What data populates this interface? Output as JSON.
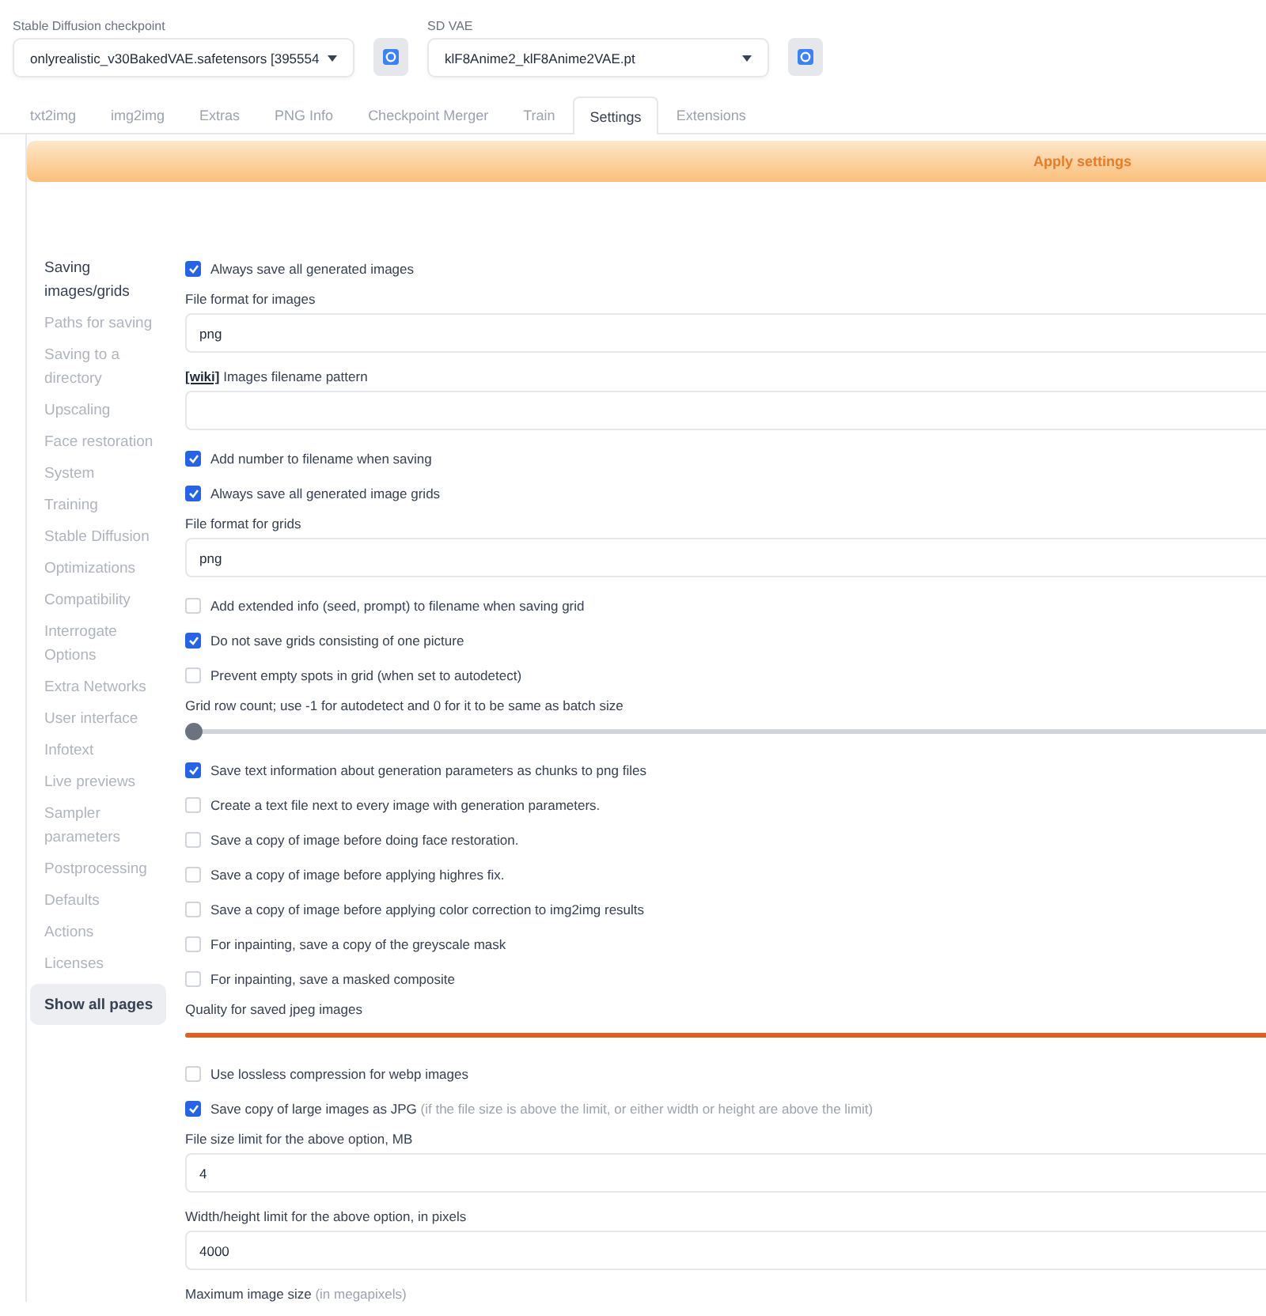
{
  "top_bar": {
    "checkpoint": {
      "label": "Stable Diffusion checkpoint",
      "value": "onlyrealistic_v30BakedVAE.safetensors [395554"
    },
    "vae": {
      "label": "SD VAE",
      "value": "klF8Anime2_klF8Anime2VAE.pt"
    }
  },
  "tabs": [
    {
      "label": "txt2img",
      "selected": false
    },
    {
      "label": "img2img",
      "selected": false
    },
    {
      "label": "Extras",
      "selected": false
    },
    {
      "label": "PNG Info",
      "selected": false
    },
    {
      "label": "Checkpoint Merger",
      "selected": false
    },
    {
      "label": "Train",
      "selected": false
    },
    {
      "label": "Settings",
      "selected": true
    },
    {
      "label": "Extensions",
      "selected": false
    }
  ],
  "apply_button": "Apply settings",
  "sidebar": {
    "items": [
      {
        "label": "Saving images/grids",
        "selected": true
      },
      {
        "label": "Paths for saving",
        "selected": false
      },
      {
        "label": "Saving to a directory",
        "selected": false
      },
      {
        "label": "Upscaling",
        "selected": false
      },
      {
        "label": "Face restoration",
        "selected": false
      },
      {
        "label": "System",
        "selected": false
      },
      {
        "label": "Training",
        "selected": false
      },
      {
        "label": "Stable Diffusion",
        "selected": false
      },
      {
        "label": "Optimizations",
        "selected": false
      },
      {
        "label": "Compatibility",
        "selected": false
      },
      {
        "label": "Interrogate Options",
        "selected": false
      },
      {
        "label": "Extra Networks",
        "selected": false
      },
      {
        "label": "User interface",
        "selected": false
      },
      {
        "label": "Infotext",
        "selected": false
      },
      {
        "label": "Live previews",
        "selected": false
      },
      {
        "label": "Sampler parameters",
        "selected": false
      },
      {
        "label": "Postprocessing",
        "selected": false
      },
      {
        "label": "Defaults",
        "selected": false
      },
      {
        "label": "Actions",
        "selected": false
      },
      {
        "label": "Licenses",
        "selected": false
      }
    ],
    "show_all_button": "Show all pages"
  },
  "settings": [
    {
      "kind": "checkbox",
      "label": "Always save all generated images",
      "checked": true
    },
    {
      "kind": "field",
      "label": "File format for images",
      "value": "png"
    },
    {
      "kind": "field",
      "link": "[wiki]",
      "label": "Images filename pattern"
    },
    {
      "kind": "checkbox",
      "label": "Add number to filename when saving",
      "checked": true
    },
    {
      "kind": "checkbox",
      "label": "Always save all generated image grids",
      "checked": true
    },
    {
      "kind": "field",
      "label": "File format for grids",
      "value": "png"
    },
    {
      "kind": "checkbox",
      "label": "Add extended info (seed, prompt) to filename when saving grid",
      "checked": false
    },
    {
      "kind": "checkbox",
      "label": "Do not save grids consisting of one picture",
      "checked": true
    },
    {
      "kind": "checkbox",
      "label": "Prevent empty spots in grid (when set to autodetect)",
      "checked": false
    },
    {
      "kind": "slider",
      "label": "Grid row count; use -1 for autodetect and 0 for it to be same as batch size",
      "level": 0
    },
    {
      "kind": "checkbox",
      "label": "Save text information about generation parameters as chunks to png files",
      "checked": true
    },
    {
      "kind": "checkbox",
      "label": "Create a text file next to every image with generation parameters.",
      "checked": false
    },
    {
      "kind": "checkbox",
      "label": "Save a copy of image before doing face restoration.",
      "checked": false
    },
    {
      "kind": "checkbox",
      "label": "Save a copy of image before applying highres fix.",
      "checked": false
    },
    {
      "kind": "checkbox",
      "label": "Save a copy of image before applying color correction to img2img results",
      "checked": false
    },
    {
      "kind": "checkbox",
      "label": "For inpainting, save a copy of the greyscale mask",
      "checked": false
    },
    {
      "kind": "checkbox",
      "label": "For inpainting, save a masked composite",
      "checked": false
    },
    {
      "kind": "slider",
      "label": "Quality for saved jpeg images",
      "level": 1
    },
    {
      "kind": "checkbox",
      "label": "Use lossless compression for webp images",
      "checked": false
    },
    {
      "kind": "checkbox",
      "label": "Save copy of large images as JPG",
      "note": "(if the file size is above the limit, or either width or height are above the limit)",
      "checked": true
    },
    {
      "kind": "field",
      "label": "File size limit for the above option, MB",
      "value": "4"
    },
    {
      "kind": "field",
      "label": "Width/height limit for the above option, in pixels",
      "value": "4000"
    },
    {
      "kind": "label",
      "label": "Maximum image size",
      "note": "(in megapixels)"
    }
  ]
}
